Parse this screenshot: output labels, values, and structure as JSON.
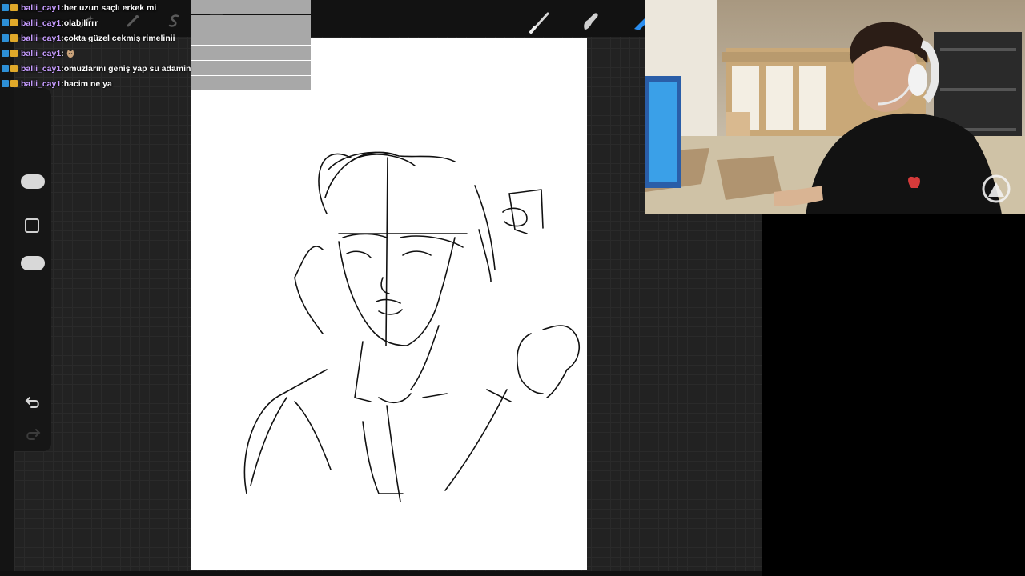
{
  "chat": {
    "messages": [
      {
        "user": "balli_cay1",
        "sep": " : ",
        "text": "her uzun saçlı erkek mi"
      },
      {
        "user": "balli_cay1",
        "sep": " : ",
        "text": "olabilirrr"
      },
      {
        "user": "balli_cay1",
        "sep": " : ",
        "text": "çokta güzel cekmiş rimelinii"
      },
      {
        "user": "balli_cay1",
        "sep": " : ",
        "text": ""
      },
      {
        "user": "balli_cay1",
        "sep": " : ",
        "text": "omuzlarını geniş yap su adamin"
      },
      {
        "user": "balli_cay1",
        "sep": " : ",
        "text": "hacim ne ya"
      }
    ]
  },
  "toolbar": {
    "icons": [
      "wand-icon",
      "adjustments-icon",
      "selection-icon",
      "transform-icon",
      "brush-icon",
      "smudge-icon",
      "eraser-icon"
    ]
  },
  "sidebar": {
    "icons": [
      "brush-size-slider",
      "modify-button",
      "opacity-slider",
      "undo-icon",
      "redo-icon"
    ]
  },
  "colors": {
    "app_bg": "#1e1e1e",
    "canvas": "#ffffff",
    "chat_user": "#c79dff",
    "chat_text": "#ffffff",
    "eraser_accent": "#2a8ef0"
  }
}
